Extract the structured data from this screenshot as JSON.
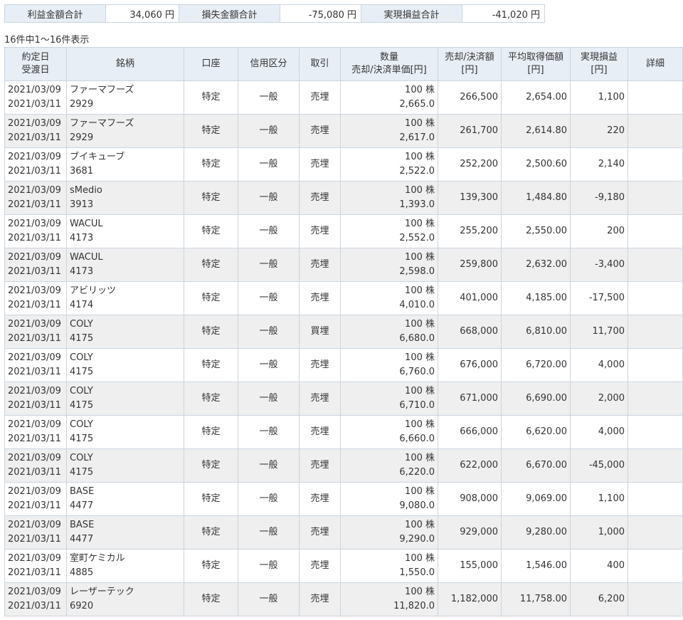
{
  "summary": {
    "profit_label": "利益金額合計",
    "profit_value": "34,060 円",
    "loss_label": "損失金額合計",
    "loss_value": "-75,080 円",
    "realized_label": "実現損益合計",
    "realized_value": "-41,020 円"
  },
  "count_text": "16件中1～16件表示",
  "headers": {
    "contract_date": "約定日",
    "delivery_date": "受渡日",
    "issue": "銘柄",
    "account": "口座",
    "credit": "信用区分",
    "trade": "取引",
    "quantity": "数量",
    "settle_price": "売却/決済単価[円]",
    "settle_amount_1": "売却/決済額",
    "settle_amount_2": "[円]",
    "avg_cost_1": "平均取得価額",
    "avg_cost_2": "[円]",
    "pnl_1": "実現損益",
    "pnl_2": "[円]",
    "detail": "詳細"
  },
  "rows": [
    {
      "contract": "2021/03/09",
      "delivery": "2021/03/11",
      "name": "ファーマフーズ",
      "code": "2929",
      "account": "特定",
      "credit": "一般",
      "trade": "売埋",
      "qty": "100 株",
      "price": "2,665.0",
      "amount": "266,500",
      "avg": "2,654.00",
      "pnl": "1,100"
    },
    {
      "contract": "2021/03/09",
      "delivery": "2021/03/11",
      "name": "ファーマフーズ",
      "code": "2929",
      "account": "特定",
      "credit": "一般",
      "trade": "売埋",
      "qty": "100 株",
      "price": "2,617.0",
      "amount": "261,700",
      "avg": "2,614.80",
      "pnl": "220"
    },
    {
      "contract": "2021/03/09",
      "delivery": "2021/03/11",
      "name": "ブイキューブ",
      "code": "3681",
      "account": "特定",
      "credit": "一般",
      "trade": "売埋",
      "qty": "100 株",
      "price": "2,522.0",
      "amount": "252,200",
      "avg": "2,500.60",
      "pnl": "2,140"
    },
    {
      "contract": "2021/03/09",
      "delivery": "2021/03/11",
      "name": "sMedio",
      "code": "3913",
      "account": "特定",
      "credit": "一般",
      "trade": "売埋",
      "qty": "100 株",
      "price": "1,393.0",
      "amount": "139,300",
      "avg": "1,484.80",
      "pnl": "-9,180"
    },
    {
      "contract": "2021/03/09",
      "delivery": "2021/03/11",
      "name": "WACUL",
      "code": "4173",
      "account": "特定",
      "credit": "一般",
      "trade": "売埋",
      "qty": "100 株",
      "price": "2,552.0",
      "amount": "255,200",
      "avg": "2,550.00",
      "pnl": "200"
    },
    {
      "contract": "2021/03/09",
      "delivery": "2021/03/11",
      "name": "WACUL",
      "code": "4173",
      "account": "特定",
      "credit": "一般",
      "trade": "売埋",
      "qty": "100 株",
      "price": "2,598.0",
      "amount": "259,800",
      "avg": "2,632.00",
      "pnl": "-3,400"
    },
    {
      "contract": "2021/03/09",
      "delivery": "2021/03/11",
      "name": "アビリッツ",
      "code": "4174",
      "account": "特定",
      "credit": "一般",
      "trade": "売埋",
      "qty": "100 株",
      "price": "4,010.0",
      "amount": "401,000",
      "avg": "4,185.00",
      "pnl": "-17,500"
    },
    {
      "contract": "2021/03/09",
      "delivery": "2021/03/11",
      "name": "COLY",
      "code": "4175",
      "account": "特定",
      "credit": "一般",
      "trade": "買埋",
      "qty": "100 株",
      "price": "6,680.0",
      "amount": "668,000",
      "avg": "6,810.00",
      "pnl": "11,700"
    },
    {
      "contract": "2021/03/09",
      "delivery": "2021/03/11",
      "name": "COLY",
      "code": "4175",
      "account": "特定",
      "credit": "一般",
      "trade": "売埋",
      "qty": "100 株",
      "price": "6,760.0",
      "amount": "676,000",
      "avg": "6,720.00",
      "pnl": "4,000"
    },
    {
      "contract": "2021/03/09",
      "delivery": "2021/03/11",
      "name": "COLY",
      "code": "4175",
      "account": "特定",
      "credit": "一般",
      "trade": "売埋",
      "qty": "100 株",
      "price": "6,710.0",
      "amount": "671,000",
      "avg": "6,690.00",
      "pnl": "2,000"
    },
    {
      "contract": "2021/03/09",
      "delivery": "2021/03/11",
      "name": "COLY",
      "code": "4175",
      "account": "特定",
      "credit": "一般",
      "trade": "売埋",
      "qty": "100 株",
      "price": "6,660.0",
      "amount": "666,000",
      "avg": "6,620.00",
      "pnl": "4,000"
    },
    {
      "contract": "2021/03/09",
      "delivery": "2021/03/11",
      "name": "COLY",
      "code": "4175",
      "account": "特定",
      "credit": "一般",
      "trade": "売埋",
      "qty": "100 株",
      "price": "6,220.0",
      "amount": "622,000",
      "avg": "6,670.00",
      "pnl": "-45,000"
    },
    {
      "contract": "2021/03/09",
      "delivery": "2021/03/11",
      "name": "BASE",
      "code": "4477",
      "account": "特定",
      "credit": "一般",
      "trade": "売埋",
      "qty": "100 株",
      "price": "9,080.0",
      "amount": "908,000",
      "avg": "9,069.00",
      "pnl": "1,100"
    },
    {
      "contract": "2021/03/09",
      "delivery": "2021/03/11",
      "name": "BASE",
      "code": "4477",
      "account": "特定",
      "credit": "一般",
      "trade": "売埋",
      "qty": "100 株",
      "price": "9,290.0",
      "amount": "929,000",
      "avg": "9,280.00",
      "pnl": "1,000"
    },
    {
      "contract": "2021/03/09",
      "delivery": "2021/03/11",
      "name": "室町ケミカル",
      "code": "4885",
      "account": "特定",
      "credit": "一般",
      "trade": "売埋",
      "qty": "100 株",
      "price": "1,550.0",
      "amount": "155,000",
      "avg": "1,546.00",
      "pnl": "400"
    },
    {
      "contract": "2021/03/09",
      "delivery": "2021/03/11",
      "name": "レーザーテック",
      "code": "6920",
      "account": "特定",
      "credit": "一般",
      "trade": "売埋",
      "qty": "100 株",
      "price": "11,820.0",
      "amount": "1,182,000",
      "avg": "11,758.00",
      "pnl": "6,200"
    }
  ]
}
